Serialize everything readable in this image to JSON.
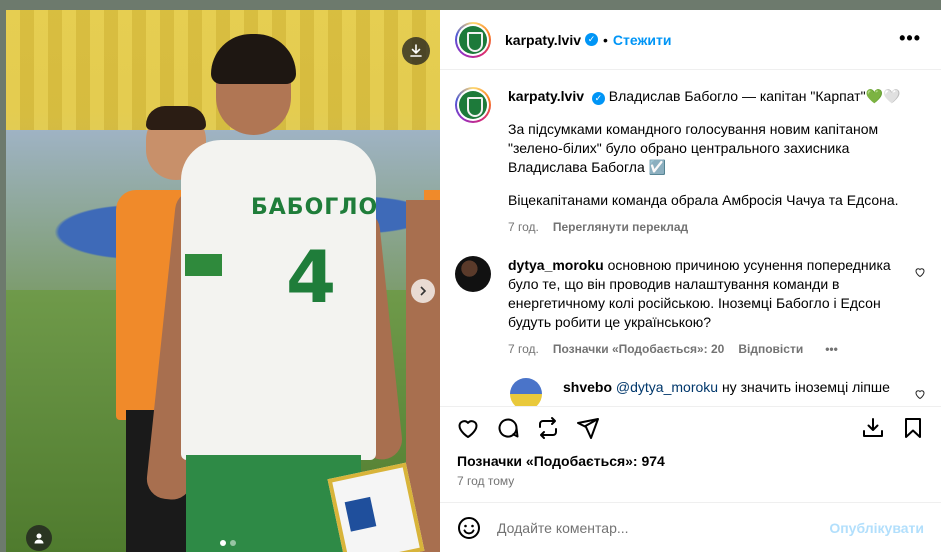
{
  "post": {
    "username": "karpaty.lviv",
    "follow_label": "Стежити",
    "separator": "•",
    "more_label": "•••",
    "download_icon": "download-icon",
    "carousel": {
      "slides": 2,
      "active": 1
    },
    "jersey": {
      "name": "БАБОГЛО",
      "number": "4"
    }
  },
  "caption": {
    "username": "karpaty.lviv",
    "title": "Владислав Бабогло — капітан \"Карпат\"💚🤍",
    "paragraph1": "За підсумками командного голосування новим капітаном \"зелено-білих\" було обрано центрального захисника Владислава Бабогла ☑️",
    "paragraph2": "Віцекапітанами команда обрала Амбросія Чачуа та Едсона.",
    "time": "7 год.",
    "translate_label": "Переглянути переклад"
  },
  "comments": [
    {
      "username": "dytya_moroku",
      "text": "основною причиною усунення попередника було те, що він проводив налаштування команди в енергетичному колі російською. Іноземці Бабогло і Едсон будуть робити це українською?",
      "time": "7 год.",
      "likes": "Позначки «Подобається»: 20",
      "reply_label": "Відповісти",
      "more": "•••"
    },
    {
      "username": "shvebo",
      "mention": "@dytya_moroku",
      "text": "ну значить іноземці ліпше"
    }
  ],
  "footer": {
    "likes": "Позначки «Подобається»: 974",
    "time": "7 год тому",
    "add_comment_placeholder": "Додайте коментар...",
    "publish_label": "Опублікувати"
  },
  "colors": {
    "accent": "#0095f6",
    "club_green": "#1d7a3a",
    "meta_gray": "#737373"
  }
}
